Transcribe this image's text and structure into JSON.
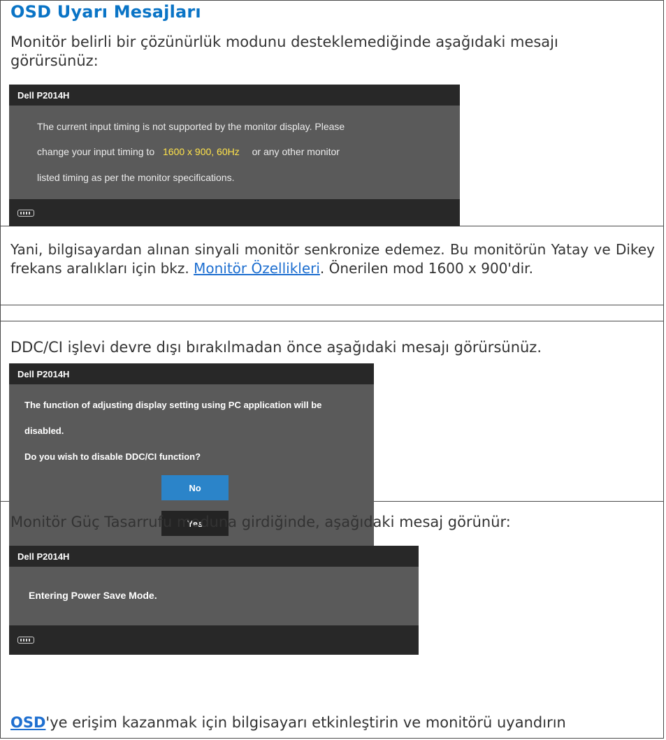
{
  "title": "OSD Uyarı Mesajları",
  "section1": {
    "intro": "Monitör belirli bir çözünürlük modunu desteklemediğinde aşağıdaki mesajı görürsünüz:",
    "osd": {
      "brand": "Dell P2014H",
      "line1": "The current input timing is not supported by the monitor display. Please",
      "line2_pre": "change your input timing to ",
      "line2_highlight": "1600 x 900, 60Hz",
      "line2_post": "or any other monitor",
      "line3": "listed timing as per the monitor specifications.",
      "footer_icon": "vga-connector-icon"
    }
  },
  "section2": {
    "text_pre": "Yani, bilgisayardan alınan sinyali monitör senkronize edemez. Bu monitörün Yatay ve Dikey frekans aralıkları için bkz. ",
    "link": "Monitör Özellikleri",
    "text_post": ". Önerilen mod 1600 x 900'dir."
  },
  "section3": {
    "intro": "DDC/CI işlevi devre dışı bırakılmadan önce aşağıdaki mesajı görürsünüz.",
    "osd": {
      "brand": "Dell P2014H",
      "line1": "The function of adjusting display setting using PC application will be",
      "line2": "disabled.",
      "line3": "Do you wish to disable DDC/CI function?",
      "no_label": "No",
      "yes_label": "Yes"
    }
  },
  "section4": {
    "intro": "Monitör Güç Tasarrufu moduna girdiğinde, aşağıdaki mesaj görünür:",
    "osd": {
      "brand": "Dell P2014H",
      "message": "Entering Power Save Mode.",
      "footer_icon": "vga-connector-icon"
    }
  },
  "section5": {
    "link": "OSD",
    "text": "'ye erişim kazanmak için bilgisayarı etkinleştirin ve monitörü uyandırın"
  },
  "colors": {
    "title": "#0a74c6",
    "link": "#1e6fd0",
    "osd_bar": "#282828",
    "osd_body": "#5a5a5a",
    "highlight": "#ffe34a",
    "no_button": "#2b84c9"
  }
}
